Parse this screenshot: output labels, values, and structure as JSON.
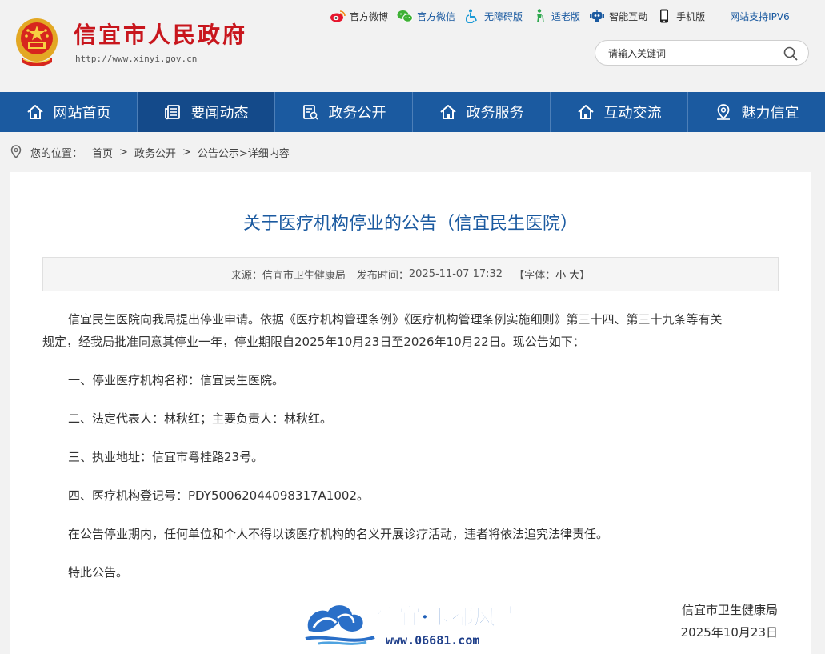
{
  "header": {
    "site_title": "信宜市人民政府",
    "site_url": "http://www.xinyi.gov.cn",
    "links": [
      {
        "label": "官方微博",
        "icon": "weibo-icon"
      },
      {
        "label": "官方微信",
        "icon": "wechat-icon"
      },
      {
        "label": "无障碍版",
        "icon": "accessibility-icon"
      },
      {
        "label": "适老版",
        "icon": "elderly-icon"
      },
      {
        "label": "智能互动",
        "icon": "robot-icon"
      },
      {
        "label": "手机版",
        "icon": "mobile-icon"
      }
    ],
    "ipv6": "网站支持IPV6",
    "search_placeholder": "请输入关键词"
  },
  "nav": {
    "items": [
      {
        "label": "网站首页",
        "icon": "home-icon"
      },
      {
        "label": "要闻动态",
        "icon": "news-icon"
      },
      {
        "label": "政务公开",
        "icon": "document-icon"
      },
      {
        "label": "政务服务",
        "icon": "home-icon"
      },
      {
        "label": "互动交流",
        "icon": "home-icon"
      },
      {
        "label": "魅力信宜",
        "icon": "location-icon"
      }
    ],
    "active_index": 1
  },
  "breadcrumb": {
    "prefix": "您的位置：",
    "home": "首页",
    "sep": ">",
    "section": "政务公开",
    "subsection": "公告公示",
    "current": ">详细内容"
  },
  "article": {
    "title": "关于医疗机构停业的公告（信宜民生医院）",
    "meta": {
      "source_label": "来源：",
      "source": "信宜市卫生健康局",
      "time_label": "发布时间：",
      "time": "2025-11-07 17:32",
      "font_label": "【字体：",
      "font_small": "小",
      "font_large": "大",
      "font_end": "】"
    },
    "intro_line1": "信宜民生医院向我局提出停业申请。依据《医疗机构管理条例》《医疗机构管理条例实施细则》第三十四、第三十九条等有关",
    "intro_line2": "规定，经我局批准同意其停业一年，停业期限自2025年10月23日至2026年10月22日。现公告如下：",
    "items": [
      "一、停业医疗机构名称：信宜民生医院。",
      "二、法定代表人：林秋红；主要负责人：林秋红。",
      "三、执业地址：信宜市粤桂路23号。",
      "四、医疗机构登记号：PDY50062044098317A1002。",
      "在公告停业期内，任何单位和个人不得以该医疗机构的名义开展诊疗活动，违者将依法追究法律责任。",
      "特此公告。"
    ],
    "signature_org": "信宜市卫生健康局",
    "signature_date": "2025年10月23日"
  },
  "watermark": {
    "title": "信宜·玉都风情",
    "url": "www.06681.com"
  },
  "colors": {
    "brand_blue": "#1b5aa0",
    "title_red": "#c8161d"
  }
}
